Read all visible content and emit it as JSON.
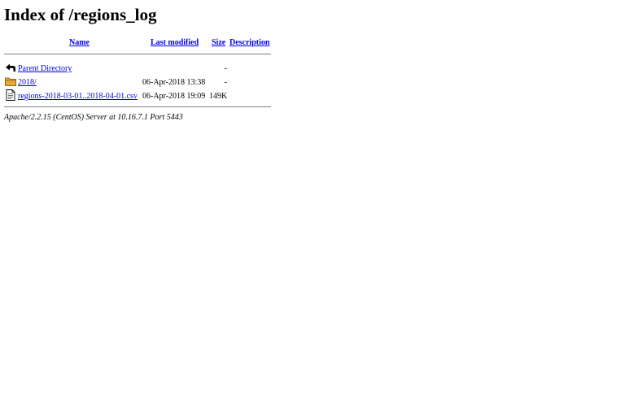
{
  "page": {
    "title": "Index of /regions_log"
  },
  "columns": {
    "name": "Name",
    "last_modified": "Last modified",
    "size": "Size",
    "description": "Description"
  },
  "entries": [
    {
      "icon": "back-arrow-icon",
      "name": "Parent Directory",
      "last_modified": "",
      "size": "-",
      "description": ""
    },
    {
      "icon": "folder-icon",
      "name": "2018/",
      "last_modified": "06-Apr-2018 13:38",
      "size": "-",
      "description": ""
    },
    {
      "icon": "text-file-icon",
      "name": "regions-2018-03-01..2018-04-01.csv",
      "last_modified": "06-Apr-2018 19:09",
      "size": "149K",
      "description": ""
    }
  ],
  "footer": {
    "server_signature": "Apache/2.2.15 (CentOS) Server at 10.16.7.1 Port 5443"
  },
  "colors": {
    "link": "#0000ee",
    "rule": "#7f7f7f",
    "folder": "#e8a93a"
  }
}
